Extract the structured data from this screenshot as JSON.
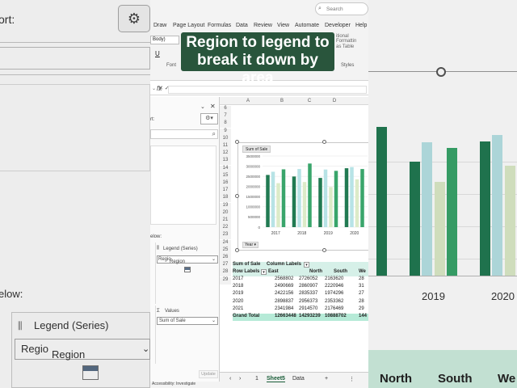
{
  "left_panel": {
    "text_ort": "ort:",
    "text_elow": "elow:",
    "legend_label": "Legend (Series)",
    "legend_value": "Regio",
    "legend_drag": "Region"
  },
  "ribbon": {
    "search_placeholder": "Search",
    "menu": [
      "Draw",
      "Page Layout",
      "Formulas",
      "Data",
      "Review",
      "View",
      "Automate",
      "Developer",
      "Help"
    ],
    "font_name": "Body)",
    "font_label": "Font",
    "style_text_1": "itional Formattin",
    "style_text_2": "as Table",
    "style_text_3": "Styles",
    "format_u": "U",
    "overlay_title": "Region to legend to break it down by area"
  },
  "formula_bar": {
    "fx": "fx"
  },
  "field_pane": {
    "text_rt": "rt:",
    "text_elow": "elow:",
    "legend_label": "Legend (Series)",
    "legend_chip": "Regio",
    "legend_drag": "Region",
    "values_label": "Values",
    "values_chip": "Sum of Sale",
    "update_button": "Update"
  },
  "grid": {
    "columns": [
      "A",
      "B",
      "C",
      "D"
    ],
    "rows": [
      "6",
      "7",
      "8",
      "9",
      "10",
      "11",
      "12",
      "13",
      "14",
      "15",
      "16",
      "17",
      "18",
      "19",
      "20",
      "21",
      "22",
      "23",
      "24",
      "25",
      "26",
      "27",
      "28",
      "29"
    ],
    "pivot_header": {
      "sum": "Sum of Sale",
      "col_labels": "Column Labels"
    },
    "pivot_cols": [
      "Row Labels",
      "East",
      "North",
      "South",
      "We"
    ],
    "pivot_rows": [
      {
        "label": "2017",
        "east": "2568802",
        "north": "2726052",
        "south": "2163620",
        "we": "28"
      },
      {
        "label": "2018",
        "east": "2490669",
        "north": "2860907",
        "south": "2220946",
        "we": "31"
      },
      {
        "label": "2019",
        "east": "2422156",
        "north": "2835337",
        "south": "1974296",
        "we": "27"
      },
      {
        "label": "2020",
        "east": "2898837",
        "north": "2956373",
        "south": "2353362",
        "we": "28"
      },
      {
        "label": "2021",
        "east": "2341984",
        "north": "2914570",
        "south": "2176469",
        "we": "29"
      }
    ],
    "grand_total": {
      "label": "Grand Total",
      "east": "12663448",
      "north": "14293239",
      "south": "10888702",
      "we": "144"
    }
  },
  "chart_data": {
    "type": "bar",
    "title": "",
    "field_button": "Sum of Sale",
    "axis_button": "Year",
    "categories": [
      "2017",
      "2018",
      "2019",
      "2020"
    ],
    "y_ticks": [
      "3500000",
      "3000000",
      "2500000",
      "2000000",
      "1500000",
      "1000000",
      "500000",
      "0"
    ],
    "ylim": [
      0,
      3500000
    ],
    "series": [
      {
        "values": [
          2568802,
          2490669,
          2422156,
          2898837
        ],
        "color": "#217a52"
      },
      {
        "values": [
          2726052,
          2860907,
          2835337,
          2956373
        ],
        "color": "#b7e3e6"
      },
      {
        "values": [
          2163620,
          2220946,
          1974296,
          2353362
        ],
        "color": "#dcebc8"
      },
      {
        "values": [
          2845000,
          3130000,
          2770000,
          2860000
        ],
        "color": "#39a56b"
      }
    ]
  },
  "sheet_tabs": {
    "tabs": [
      "Sheet5",
      "Data"
    ],
    "active": "Sheet5",
    "add": "+",
    "page": "1"
  },
  "status_bar": {
    "text": "Accessibility: Investigate"
  },
  "right_panel": {
    "years": [
      "2019",
      "2020"
    ],
    "headers": [
      "North",
      "South",
      "We"
    ]
  },
  "colors": {
    "overlay_bg": "#29553c",
    "pivot_header": "#d6f0e8",
    "grand_total": "#b6ead7"
  }
}
